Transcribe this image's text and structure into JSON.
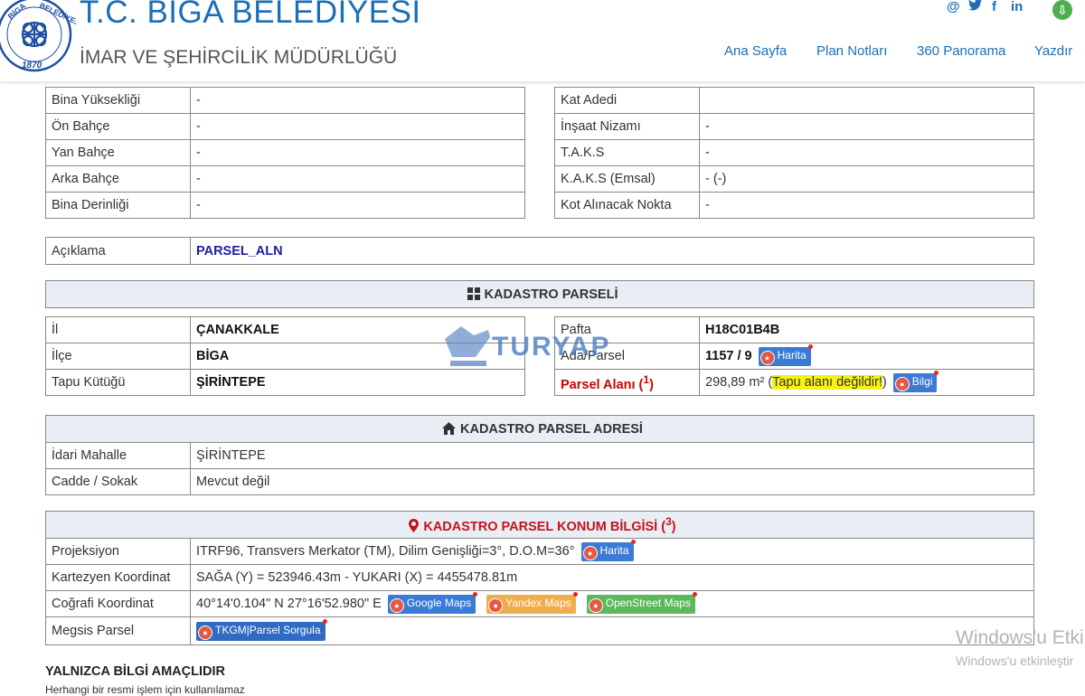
{
  "header": {
    "logo": {
      "icon": "biga-municipality-seal",
      "top_text": "BİGA BELEDİYESİ",
      "year": "1870"
    },
    "title": "T.C. BİGA BELEDİYESİ",
    "subtitle": "İMAR VE ŞEHİRCİLİK MÜDÜRLÜĞÜ",
    "social": [
      {
        "name": "email-icon",
        "glyph": "@"
      },
      {
        "name": "twitter-icon",
        "glyph": "🐦"
      },
      {
        "name": "facebook-icon",
        "glyph": "f"
      },
      {
        "name": "linkedin-icon",
        "glyph": "in"
      }
    ],
    "download_icon": "download-icon",
    "nav": [
      "Ana Sayfa",
      "Plan Notları",
      "360 Panorama",
      "Yazdır"
    ]
  },
  "building_left": [
    {
      "label": "Bina Yüksekliği",
      "value": "-"
    },
    {
      "label": "Ön Bahçe",
      "value": "-"
    },
    {
      "label": "Yan Bahçe",
      "value": "-"
    },
    {
      "label": "Arka Bahçe",
      "value": "-"
    },
    {
      "label": "Bina Derinliği",
      "value": "-"
    }
  ],
  "building_right": [
    {
      "label": "Kat Adedi",
      "value": ""
    },
    {
      "label": "İnşaat Nizamı",
      "value": "-"
    },
    {
      "label": "T.A.K.S",
      "value": "-"
    },
    {
      "label": "K.A.K.S (Emsal)",
      "value": "- (-)"
    },
    {
      "label": "Kot Alınacak Nokta",
      "value": "-"
    }
  ],
  "aciklama": {
    "label": "Açıklama",
    "value": "PARSEL_ALN"
  },
  "kadastro_parseli": {
    "title": "KADASTRO PARSELİ",
    "left": [
      {
        "label": "İl",
        "value": "ÇANAKKALE"
      },
      {
        "label": "İlçe",
        "value": "BİGA"
      },
      {
        "label": "Tapu Kütüğü",
        "value": "ŞİRİNTEPE"
      }
    ],
    "pafta_label": "Pafta",
    "pafta_value": "H18C01B4B",
    "ada_label": "Ada/Parsel",
    "ada_value": "1157 / 9",
    "harita_label": "Harita",
    "alan_label": "Parsel Alanı (",
    "alan_sup": "1",
    "alan_label_end": ")",
    "alan_value": "298,89 m² (",
    "alan_note": "Tapu alanı değildir!",
    "alan_close": ")",
    "bilgi_label": "Bilgi"
  },
  "watermark": {
    "text": "TURYAP"
  },
  "adres": {
    "title": "KADASTRO PARSEL ADRESİ",
    "rows": [
      {
        "label": "İdari Mahalle",
        "value": "ŞİRİNTEPE"
      },
      {
        "label": "Cadde / Sokak",
        "value": "Mevcut değil"
      }
    ]
  },
  "konum": {
    "title": "KADASTRO PARSEL KONUM BİLGİSİ (",
    "title_sup": "3",
    "title_end": ")",
    "proj_label": "Projeksiyon",
    "proj_value": "ITRF96, Transvers Merkator (TM), Dilim Genişliği=3°, D.O.M=36°",
    "proj_btn": "Harita",
    "kart_label": "Kartezyen Koordinat",
    "kart_value": "SAĞA (Y) = 523946.43m - YUKARI (X) = 4455478.81m",
    "cog_label": "Coğrafi Koordinat",
    "cog_value": "40°14'0.104\" N 27°16'52.980\" E",
    "google_btn": "Google Maps",
    "yandex_btn": "Yandex Maps",
    "osm_btn": "OpenStreet Maps",
    "megsis_label": "Megsis Parsel",
    "megsis_btn": "TKGM|Parsel Sorgula"
  },
  "footer": {
    "title": "YALNIZCA BİLGİ AMAÇLIDIR",
    "subtitle": "Herhangi bir resmi işlem için kullanılamaz"
  },
  "windows_watermark": {
    "line1": "Windows'u Etki",
    "line2": "Windows'u etkinleştir"
  },
  "colors": {
    "accent": "#1a6fb8",
    "section_bg": "#e8eef3",
    "red": "#c4131d",
    "highlight": "#f7f116"
  }
}
